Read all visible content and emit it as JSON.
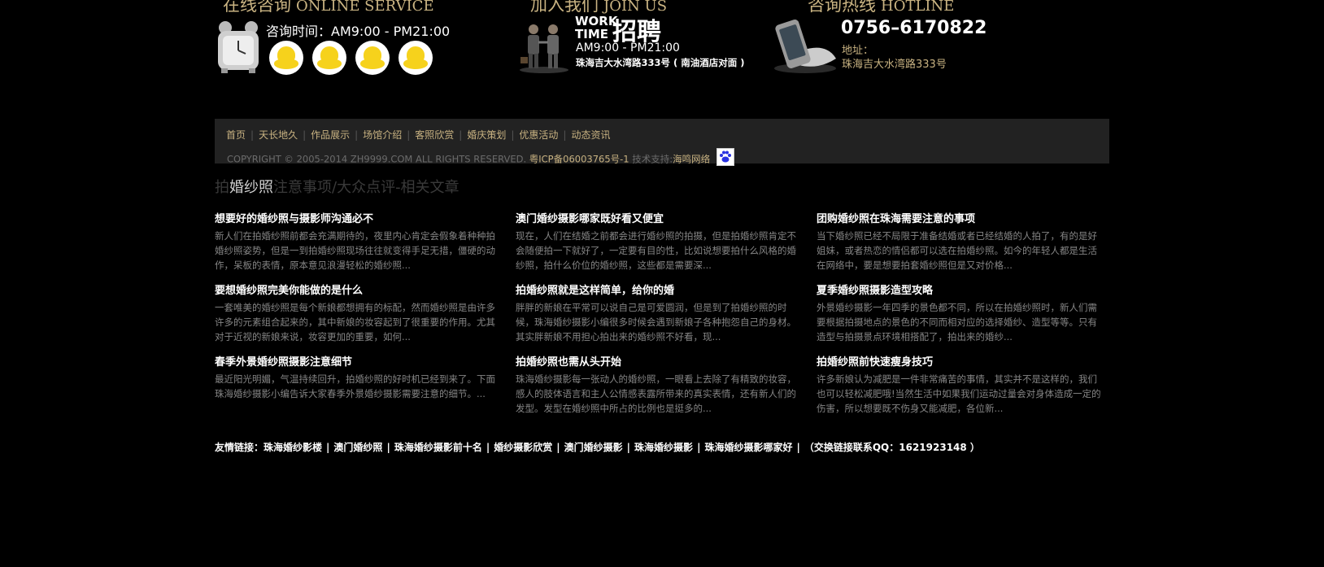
{
  "online": {
    "title_cn": "在线咨询",
    "title_en": "ONLINE SERVICE",
    "hours": "咨询时间：AM9:00 - PM21:00",
    "icons": [
      "alarm-clock-icon",
      "qq-penguin-icon"
    ]
  },
  "join": {
    "title_cn": "加入我们",
    "title_en": "JOIN US",
    "work": "WORK",
    "time": "TIME",
    "recruit": "招聘",
    "hours": "AM9:00 - PM21:00",
    "address": "珠海吉大水湾路333号 ( 南油酒店对面 )"
  },
  "hotline": {
    "title_cn": "咨询热线",
    "title_en": "HOTLINE",
    "phone": "0756–6170822",
    "address_label": "地址：",
    "address": "珠海吉大水湾路333号"
  },
  "nav": {
    "items": [
      "首页",
      "天长地久",
      "作品展示",
      "场馆介绍",
      "客照欣赏",
      "婚庆策划",
      "优惠活动",
      "动态资讯"
    ]
  },
  "copyright": {
    "text": "COPYRIGHT © 2005-2014 ZH9999.COM ALL RIGHTS RESERVED.",
    "icp": "粤ICP备06003765号-1",
    "support_label": "技术支持:",
    "support": "海鸣网络"
  },
  "articles": {
    "title_pre": "拍",
    "title_hl": "婚纱照",
    "title_post": "注意事项/大众点评-相关文章",
    "items": [
      {
        "title": "想要好的婚纱照与摄影师沟通必不",
        "desc": "新人们在拍婚纱照前都会充满期待的，夜里内心肯定会假象着种种拍婚纱照姿势，但是一到拍婚纱照现场往往就变得手足无措，僵硬的动作，呆板的表情，原本意见浪漫轻松的婚纱照..."
      },
      {
        "title": "澳门婚纱摄影哪家既好看又便宜",
        "desc": "现在，人们在结婚之前都会进行婚纱照的拍摄，但是拍婚纱照肯定不会随便拍一下就好了，一定要有目的性，比如说想要拍什么风格的婚纱照，拍什么价位的婚纱照，这些都是需要深..."
      },
      {
        "title": "团购婚纱照在珠海需要注意的事项",
        "desc": "当下婚纱照已经不局限于准备结婚或者已经结婚的人拍了，有的是好姐妹，或者热恋的情侣都可以选在拍婚纱照。如今的年轻人都是生活在网络中，要是想要拍套婚纱照但是又对价格..."
      },
      {
        "title": "要想婚纱照完美你能做的是什么",
        "desc": "一套唯美的婚纱照是每个新娘都想拥有的标配，然而婚纱照是由许多许多的元素组合起来的，其中新娘的妆容起到了很重要的作用。尤其对于近视的新娘来说，妆容更加的重要，如何..."
      },
      {
        "title": "拍婚纱照就是这样简单，给你的婚",
        "desc": "胖胖的新娘在平常可以说自己是可爱圆润，但是到了拍婚纱照的时候，珠海婚纱摄影小编很多时候会遇到新娘子各种抱怨自己的身材。其实胖新娘不用担心拍出来的婚纱照不好看，现..."
      },
      {
        "title": "夏季婚纱照摄影造型攻略",
        "desc": "外景婚纱摄影一年四季的景色都不同，所以在拍婚纱照时，新人们需要根据拍摄地点的景色的不同而相对应的选择婚纱、造型等等。只有造型与拍摄景点环境相搭配了，拍出来的婚纱..."
      },
      {
        "title": "春季外景婚纱照摄影注意细节",
        "desc": "最近阳光明媚，气温持续回升，拍婚纱照的好时机已经到来了。下面珠海婚纱摄影小编告诉大家春季外景婚纱摄影需要注意的细节。..."
      },
      {
        "title": "拍婚纱照也需从头开始",
        "desc": "珠海婚纱摄影每一张动人的婚纱照，一眼看上去除了有精致的妆容，感人的肢体语言和主人公情感表露所带来的真实表情，还有新人们的发型。发型在婚纱照中所占的比例也是挺多的..."
      },
      {
        "title": "拍婚纱照前快速瘦身技巧",
        "desc": "许多新娘认为减肥是一件非常痛苦的事情，其实并不是这样的，我们也可以轻松减肥哦!当然生活中如果我们运动过量会对身体造成一定的伤害，所以想要既不伤身又能减肥，各位新..."
      }
    ]
  },
  "links": {
    "label": "友情链接：",
    "items": [
      "珠海婚纱影楼",
      "澳门婚纱照",
      "珠海婚纱摄影前十名",
      "婚纱摄影欣赏",
      "澳门婚纱摄影",
      "珠海婚纱摄影",
      "珠海婚纱摄影哪家好"
    ],
    "contact": "（交换链接联系QQ：1621923148 ）"
  }
}
